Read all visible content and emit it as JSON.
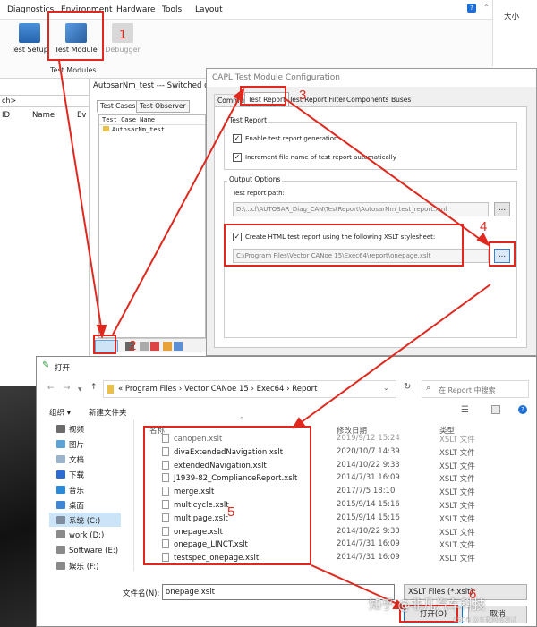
{
  "menu": {
    "items": [
      "Diagnostics",
      "Environment",
      "Hardware",
      "Tools",
      "Layout"
    ],
    "right_label": "大小"
  },
  "ribbon": {
    "buttons": [
      "Test Setup",
      "Test Module",
      "Debugger"
    ],
    "group_label": "Test Modules"
  },
  "left_pane": {
    "search_fragment": "ch>",
    "col_id": "ID",
    "col_name": "Name",
    "col_ev": "Ev"
  },
  "test_window": {
    "title": "AutosarNm_test --- Switched o",
    "tabs": [
      "Test Cases",
      "Test Observer"
    ],
    "col_header": "Test Case Name",
    "item": "AutosarNm_test"
  },
  "config_dialog": {
    "title": "CAPL Test Module Configuration",
    "tabs": [
      "Common",
      "Test Report",
      "Test Report Filter",
      "Components",
      "Buses"
    ],
    "group_test_report": "Test Report",
    "cb_enable": "Enable test report generation",
    "cb_increment": "Increment file name of test report automatically",
    "group_output": "Output Options",
    "path_label": "Test report path:",
    "path_value": "D:\\...cf\\AUTOSAR_Diag_CAN\\TestReport\\AutosarNm_test_report.xml",
    "cb_html": "Create HTML test report using the following XSLT stylesheet:",
    "xslt_value": "C:\\Program Files\\Vector CANoe 15\\Exec64\\report\\onepage.xslt",
    "browse": "..."
  },
  "open_dialog": {
    "title": "打开",
    "breadcrumb": [
      "«",
      "Program Files",
      "›",
      "Vector CANoe 15",
      "›",
      "Exec64",
      "›",
      "Report"
    ],
    "search_placeholder": "在 Report 中搜索",
    "organize": "组织 ▾",
    "new_folder": "新建文件夹",
    "nav": [
      "视频",
      "图片",
      "文档",
      "下载",
      "音乐",
      "桌面",
      "系统 (C:)",
      "work (D:)",
      "Software (E:)",
      "娱乐 (F:)"
    ],
    "columns": [
      "名称",
      "修改日期",
      "类型"
    ],
    "files": [
      {
        "name": "canopen.xslt",
        "date": "2019/9/12 15:24",
        "type": "XSLT 文件"
      },
      {
        "name": "divaExtendedNavigation.xslt",
        "date": "2020/10/7 14:39",
        "type": "XSLT 文件"
      },
      {
        "name": "extendedNavigation.xslt",
        "date": "2014/10/22 9:33",
        "type": "XSLT 文件"
      },
      {
        "name": "J1939-82_ComplianceReport.xslt",
        "date": "2014/7/31 16:09",
        "type": "XSLT 文件"
      },
      {
        "name": "merge.xslt",
        "date": "2017/7/5 18:10",
        "type": "XSLT 文件"
      },
      {
        "name": "multicycle.xslt",
        "date": "2015/9/14 15:16",
        "type": "XSLT 文件"
      },
      {
        "name": "multipage.xslt",
        "date": "2015/9/14 15:16",
        "type": "XSLT 文件"
      },
      {
        "name": "onepage.xslt",
        "date": "2014/10/22 9:33",
        "type": "XSLT 文件"
      },
      {
        "name": "onepage_LINCT.xslt",
        "date": "2014/7/31 16:09",
        "type": "XSLT 文件"
      },
      {
        "name": "testspec_onepage.xslt",
        "date": "2014/7/31 16:09",
        "type": "XSLT 文件"
      }
    ],
    "filename_label": "文件名(N):",
    "filename_value": "onepage.xslt",
    "filter": "XSLT Files (*.xslt)",
    "open_btn": "打开(O)",
    "cancel_btn": "取消"
  },
  "annotations": [
    "1",
    "2",
    "3",
    "4",
    "5",
    "6"
  ],
  "watermark": "知乎 @非凡汽车科技",
  "credit": "CSDN @车载网络测试"
}
